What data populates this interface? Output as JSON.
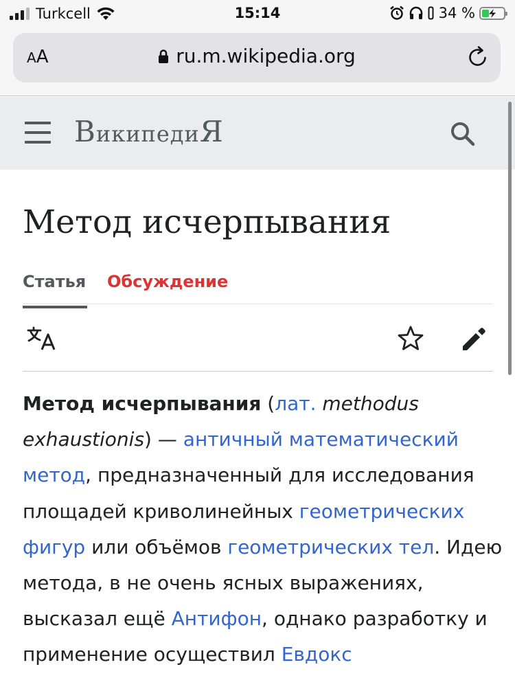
{
  "status_bar": {
    "carrier": "Turkcell",
    "time": "15:14",
    "battery_percent": "34 %",
    "battery_level": 0.34,
    "signal_bars_active": 3,
    "signal_bars_total": 4
  },
  "browser": {
    "text_size_label_small": "A",
    "text_size_label_large": "A",
    "url": "ru.m.wikipedia.org"
  },
  "header": {
    "logo_first": "В",
    "logo_rest": "икипеди",
    "logo_last": "Я"
  },
  "page": {
    "title": "Метод исчерпывания",
    "tabs": [
      {
        "label": "Статья",
        "active": true
      },
      {
        "label": "Обсуждение",
        "active": false
      }
    ]
  },
  "article": {
    "segments": [
      {
        "text": "Метод исчерпывания",
        "style": "bold"
      },
      {
        "text": " (",
        "style": "plain"
      },
      {
        "text": "лат.",
        "style": "link"
      },
      {
        "text": " ",
        "style": "plain"
      },
      {
        "text": "methodus exhaustionis",
        "style": "italic"
      },
      {
        "text": ") — ",
        "style": "plain"
      },
      {
        "text": "античный математический метод",
        "style": "link"
      },
      {
        "text": ", предназначенный для исследования площадей криволинейных ",
        "style": "plain"
      },
      {
        "text": "геометрических фигур",
        "style": "link"
      },
      {
        "text": " или объёмов ",
        "style": "plain"
      },
      {
        "text": "геометрических тел",
        "style": "link"
      },
      {
        "text": ". Идею метода, в не очень ясных выражениях, высказал ещё ",
        "style": "plain"
      },
      {
        "text": "Антифон",
        "style": "link"
      },
      {
        "text": ", однако разработку и применение осуществил ",
        "style": "plain"
      },
      {
        "text": "Евдокс",
        "style": "link"
      }
    ]
  },
  "colors": {
    "link": "#3366cc",
    "talk_tab": "#dd3333",
    "header_bg": "#eaecf0",
    "text": "#202122",
    "battery_fill": "#35c759"
  },
  "icons": {
    "menu": "hamburger-menu-icon",
    "search": "search-icon",
    "language": "language-icon",
    "watch": "star-icon",
    "edit": "pencil-icon",
    "lock": "lock-icon",
    "reload": "reload-icon"
  }
}
